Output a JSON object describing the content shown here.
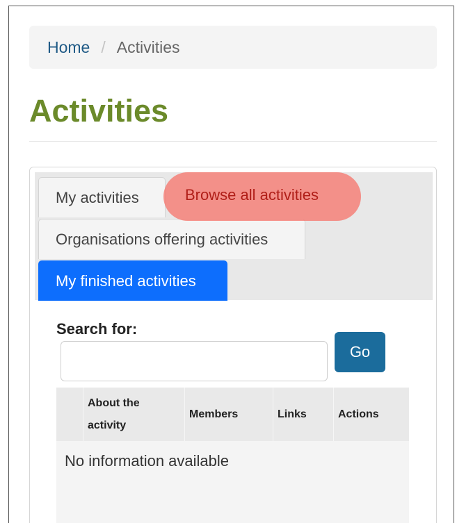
{
  "breadcrumb": {
    "home": "Home",
    "separator": "/",
    "current": "Activities"
  },
  "page": {
    "title": "Activities"
  },
  "tabs": {
    "my_activities": "My activities",
    "browse_all": "Browse all activities",
    "organisations": "Organisations offering activities",
    "finished": "My finished activities",
    "active": "My finished activities"
  },
  "search": {
    "label": "Search for:",
    "value": "",
    "placeholder": "",
    "button": "Go"
  },
  "table": {
    "columns": [
      "",
      "About the activity",
      "Members",
      "Links",
      "Actions"
    ],
    "empty_message": "No information available"
  },
  "colors": {
    "title": "#6b8a2a",
    "active_tab": "#0d6efd",
    "go_button": "#1b6c9c",
    "highlight": "#f77369"
  }
}
